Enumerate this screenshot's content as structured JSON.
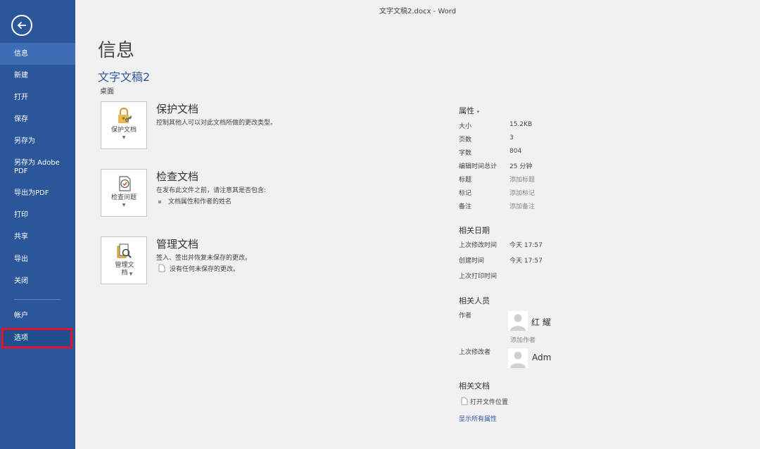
{
  "window": {
    "title": "文字文稿2.docx - Word"
  },
  "sidebar": {
    "items": [
      {
        "label": "信息"
      },
      {
        "label": "新建"
      },
      {
        "label": "打开"
      },
      {
        "label": "保存"
      },
      {
        "label": "另存为"
      },
      {
        "label": "另存为 Adobe PDF"
      },
      {
        "label": "导出为PDF"
      },
      {
        "label": "打印"
      },
      {
        "label": "共享"
      },
      {
        "label": "导出"
      },
      {
        "label": "关闭"
      },
      {
        "label": "帐户"
      },
      {
        "label": "选项"
      }
    ],
    "active_index": 0,
    "highlight_color": "#e8112d",
    "background": "#2b579a"
  },
  "main": {
    "title": "信息",
    "document_name": "文字文稿2",
    "document_location": "桌面",
    "sections": {
      "protect": {
        "button_label": "保护文档",
        "title": "保护文档",
        "description": "控制其他人可以对此文档所做的更改类型。"
      },
      "inspect": {
        "button_label": "检查问题",
        "title": "检查文档",
        "description": "在发布此文件之前，请注意其是否包含:",
        "bullet": "文档属性和作者的姓名"
      },
      "manage": {
        "button_label": "管理文档",
        "title": "管理文档",
        "description": "签入、签出并恢复未保存的更改。",
        "bullet": "没有任何未保存的更改。"
      }
    }
  },
  "properties": {
    "header": "属性",
    "rows": [
      {
        "key": "大小",
        "value": "15.2KB"
      },
      {
        "key": "页数",
        "value": "3"
      },
      {
        "key": "字数",
        "value": "804"
      },
      {
        "key": "编辑时间总计",
        "value": "25 分钟"
      },
      {
        "key": "标题",
        "value": "添加标题"
      },
      {
        "key": "标记",
        "value": "添加标记"
      },
      {
        "key": "备注",
        "value": "添加备注"
      }
    ],
    "dates": {
      "header": "相关日期",
      "modified_label": "上次修改时间",
      "modified_value": "今天 17:57",
      "created_label": "创建时间",
      "created_value": "今天 17:57",
      "printed_label": "上次打印时间"
    },
    "people": {
      "header": "相关人员",
      "author_label": "作者",
      "author_name": "红 耀",
      "add_author": "添加作者",
      "last_modified_by_label": "上次修改者",
      "last_modified_by_name": "Adm"
    },
    "related_docs": {
      "header": "相关文档",
      "open_location": "打开文件位置",
      "show_all": "显示所有属性"
    }
  }
}
